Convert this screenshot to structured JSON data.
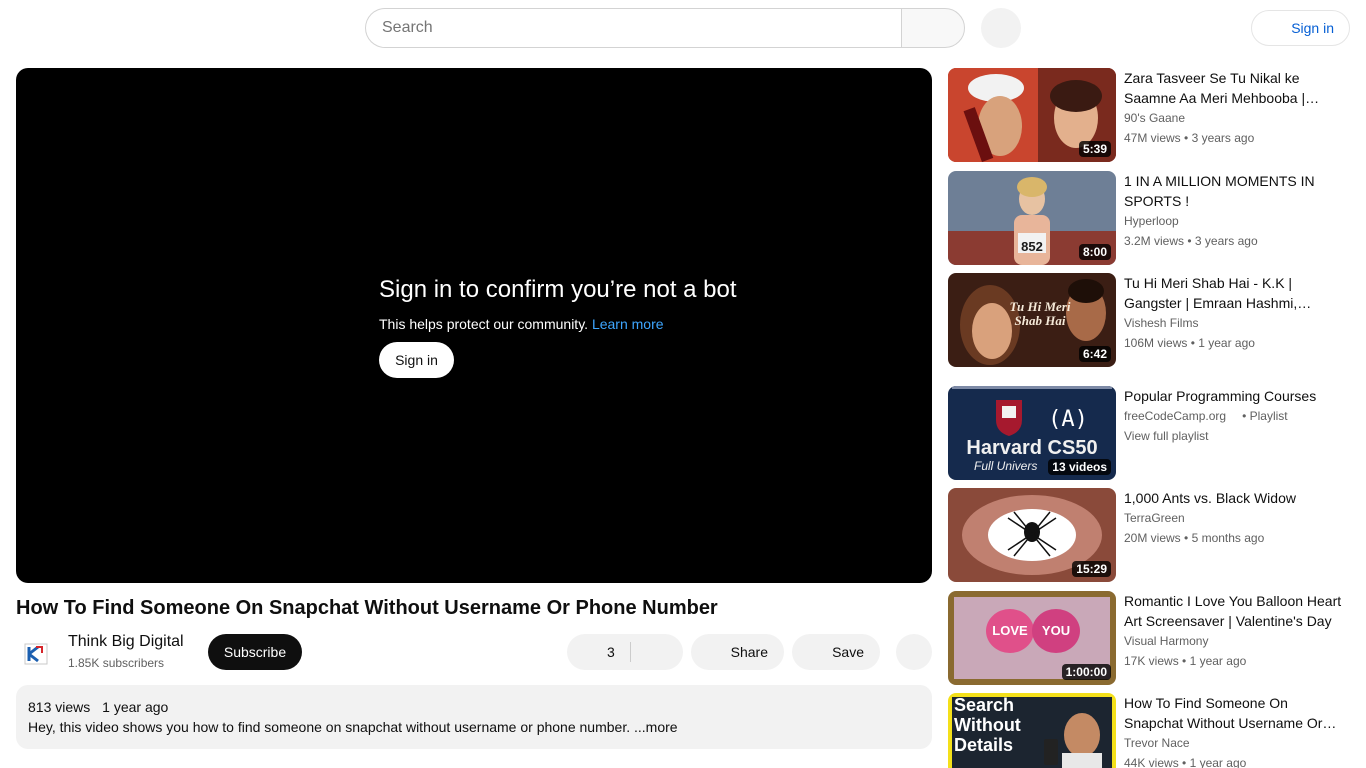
{
  "header": {
    "search_placeholder": "Search",
    "signin_label": "Sign in"
  },
  "player": {
    "title": "Sign in to confirm you’re not a bot",
    "description": "This helps protect our community.",
    "learn_more": "Learn more",
    "signin_label": "Sign in"
  },
  "video": {
    "title": "How To Find Someone On Snapchat Without Username Or Phone Number",
    "channel_name": "Think Big Digital",
    "subscribers": "1.85K subscribers",
    "subscribe_label": "Subscribe",
    "like_count": "3",
    "share_label": "Share",
    "save_label": "Save",
    "views": "813 views",
    "age": "1 year ago",
    "description": "Hey,  this video shows you how to find someone on snapchat without username or phone number. ",
    "more_label": "...more"
  },
  "recommendations": [
    {
      "title": "Zara Tasveer Se Tu Nikal ke Saamne Aa Meri Mehbooba | Pardes | Shah Rukh Khan",
      "channel": "90's Gaane",
      "views": "47M views",
      "age": "3 years ago",
      "duration": "5:39"
    },
    {
      "title": "1 IN A MILLION MOMENTS IN SPORTS !",
      "channel": "Hyperloop",
      "views": "3.2M views",
      "age": "3 years ago",
      "duration": "8:00"
    },
    {
      "title": "Tu Hi Meri Shab Hai - K.K | Gangster | Emraan Hashmi, Kangana Ranaut",
      "channel": "Vishesh Films",
      "views": "106M views",
      "age": "1 year ago",
      "duration": "6:42"
    },
    {
      "title": "Popular Programming Courses",
      "channel": "freeCodeCamp.org",
      "tag": "• Playlist",
      "sub": "View full playlist",
      "duration": "13 videos"
    },
    {
      "title": "1,000 Ants vs. Black Widow",
      "channel": "TerraGreen",
      "views": "20M views",
      "age": "5 months ago",
      "duration": "15:29"
    },
    {
      "title": "Romantic I Love You Balloon Heart Art Screensaver | Valentine's Day",
      "channel": "Visual Harmony",
      "views": "17K views",
      "age": "1 year ago",
      "duration": "1:00:00"
    },
    {
      "title": "How To Find Someone On Snapchat Without Username Or Phone Number",
      "channel": "Trevor Nace",
      "views": "44K views",
      "age": "1 year ago",
      "duration": ""
    }
  ],
  "thumb_text": {
    "t2": "852",
    "t3a": "Tu Hi Meri",
    "t3b": "Shab Hai",
    "t4a": "Harvard CS50",
    "t4b": "Full Univers",
    "t4c": "(A)",
    "t6a": "LOVE",
    "t6b": "YOU",
    "t7a": "Search",
    "t7b": "Without",
    "t7c": "Details"
  }
}
